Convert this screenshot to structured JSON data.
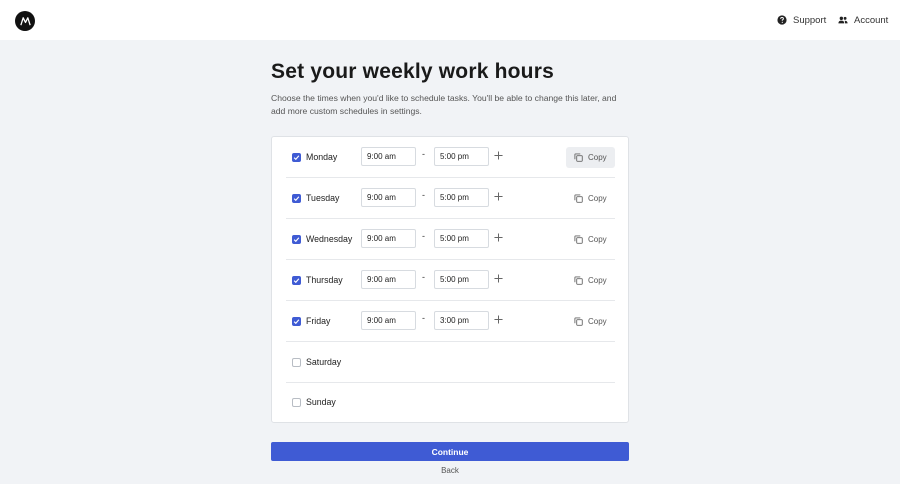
{
  "nav": {
    "support_label": "Support",
    "account_label": "Account"
  },
  "page": {
    "title": "Set your weekly work hours",
    "description": "Choose the times when you'd like to schedule tasks. You'll be able to change this later, and add more custom schedules in settings."
  },
  "days": [
    {
      "label": "Monday",
      "checked": true,
      "start": "9:00 am",
      "end": "5:00 pm",
      "copy": "Copy"
    },
    {
      "label": "Tuesday",
      "checked": true,
      "start": "9:00 am",
      "end": "5:00 pm",
      "copy": "Copy"
    },
    {
      "label": "Wednesday",
      "checked": true,
      "start": "9:00 am",
      "end": "5:00 pm",
      "copy": "Copy"
    },
    {
      "label": "Thursday",
      "checked": true,
      "start": "9:00 am",
      "end": "5:00 pm",
      "copy": "Copy"
    },
    {
      "label": "Friday",
      "checked": true,
      "start": "9:00 am",
      "end": "3:00 pm",
      "copy": "Copy"
    },
    {
      "label": "Saturday",
      "checked": false
    },
    {
      "label": "Sunday",
      "checked": false
    }
  ],
  "range_separator": "-",
  "actions": {
    "continue_label": "Continue",
    "back_label": "Back"
  },
  "colors": {
    "accent": "#3f5bd4",
    "background": "#f1f3f6"
  },
  "icons": {
    "logo": "m-logo-icon",
    "support": "help-circle-icon",
    "account": "people-icon",
    "checkbox": "check-icon",
    "add": "plus-icon",
    "copy": "copy-icon"
  }
}
